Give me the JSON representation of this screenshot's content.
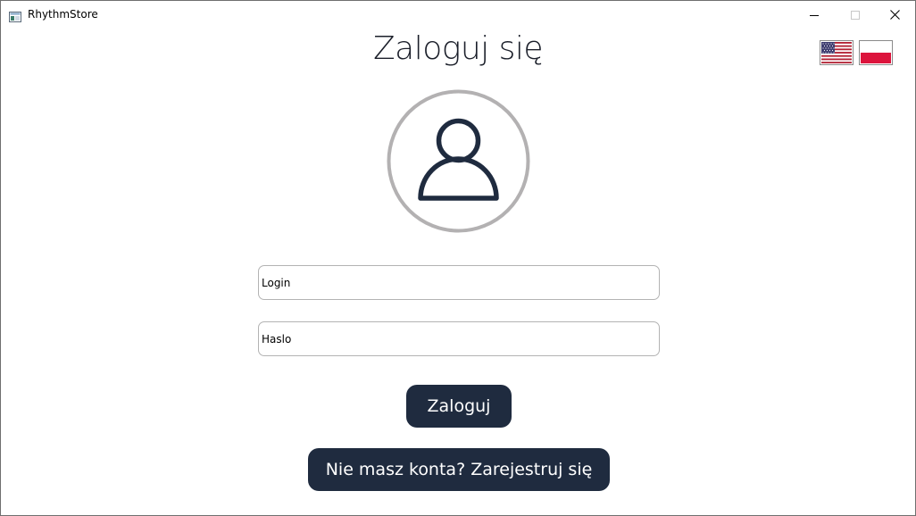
{
  "window": {
    "title": "RhythmStore",
    "icon": "app-window-icon",
    "controls": {
      "minimize_icon": "minimize-icon",
      "maximize_icon": "maximize-icon",
      "close_icon": "close-icon"
    }
  },
  "language": {
    "flags": [
      {
        "name": "us-flag-icon"
      },
      {
        "name": "pl-flag-icon"
      }
    ]
  },
  "login": {
    "title": "Zaloguj się",
    "avatar_icon": "user-icon",
    "login_field": {
      "value": "Login"
    },
    "password_field": {
      "value": "Haslo"
    },
    "login_button": "Zaloguj",
    "register_button": "Nie masz konta? Zarejestruj się"
  },
  "colors": {
    "accent": "#1f2b3f",
    "avatar_ring": "#b3b1b2",
    "background": "#ffffff"
  }
}
